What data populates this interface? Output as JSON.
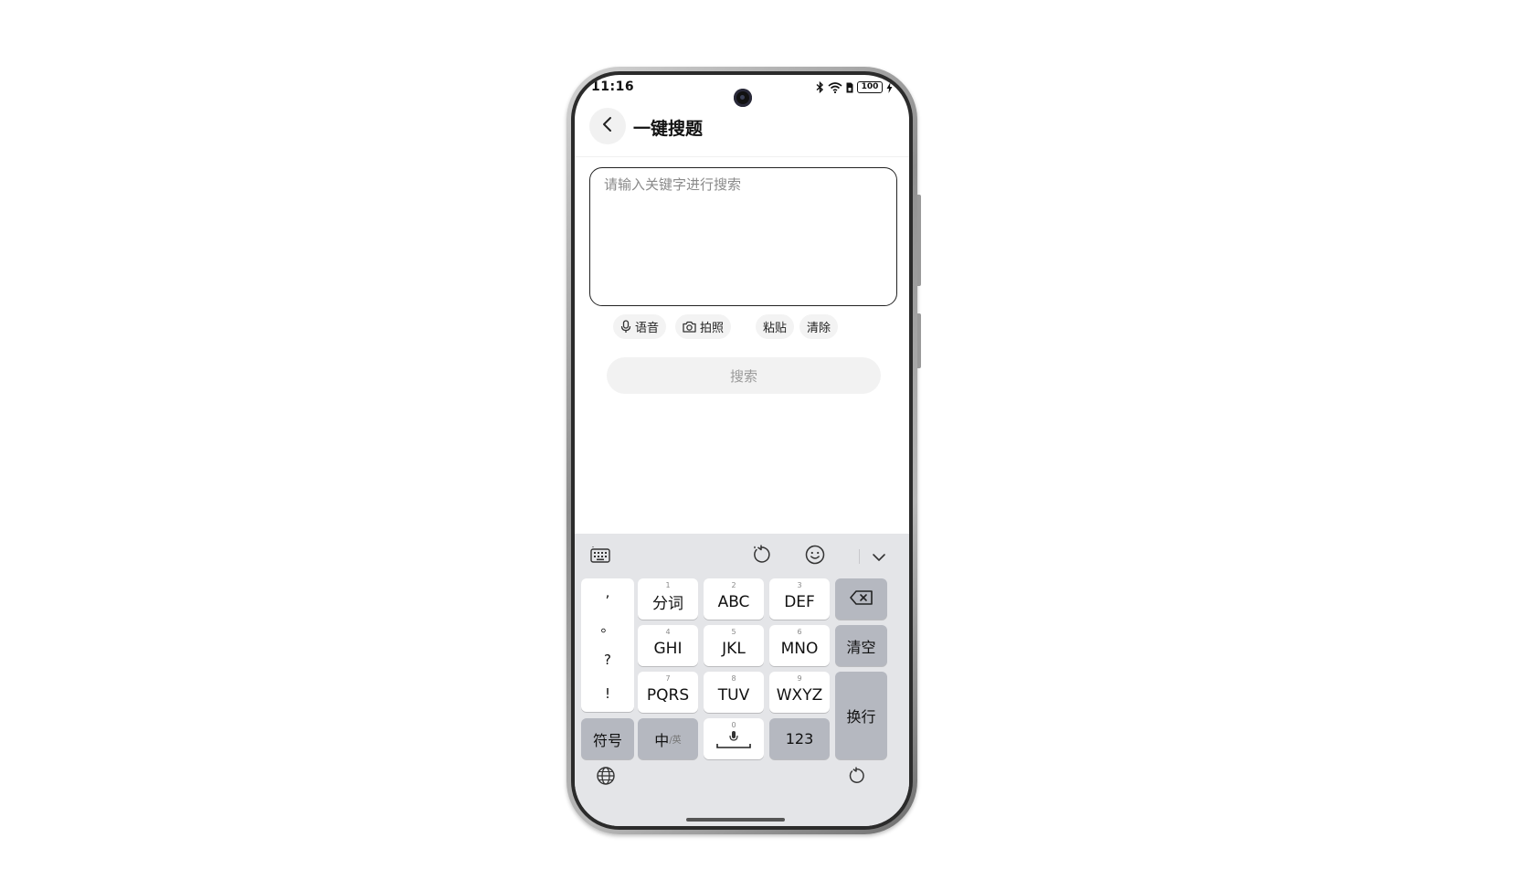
{
  "status_bar": {
    "time": "11:16",
    "battery": "100"
  },
  "header": {
    "title": "一键搜题"
  },
  "search": {
    "placeholder": "请输入关键字进行搜索",
    "value": ""
  },
  "tools": {
    "voice": "语音",
    "photo": "拍照",
    "paste": "粘贴",
    "clear": "清除"
  },
  "search_button": "搜索",
  "keyboard": {
    "punct": [
      ",",
      "。",
      "?",
      "!"
    ],
    "keys": [
      {
        "num": "1",
        "label": "分词"
      },
      {
        "num": "2",
        "label": "ABC"
      },
      {
        "num": "3",
        "label": "DEF"
      },
      {
        "num": "4",
        "label": "GHI"
      },
      {
        "num": "5",
        "label": "JKL"
      },
      {
        "num": "6",
        "label": "MNO"
      },
      {
        "num": "7",
        "label": "PQRS"
      },
      {
        "num": "8",
        "label": "TUV"
      },
      {
        "num": "9",
        "label": "WXYZ"
      }
    ],
    "clear_all": "清空",
    "newline": "换行",
    "symbols": "符号",
    "lang_main": "中",
    "lang_sub": "/英",
    "space_num": "0",
    "numeric": "123"
  },
  "icons": {
    "back": "chevron-left-icon",
    "mic": "mic-icon",
    "camera": "camera-icon",
    "backspace": "backspace-icon",
    "globe": "globe-icon",
    "emoji": "emoji-icon"
  }
}
